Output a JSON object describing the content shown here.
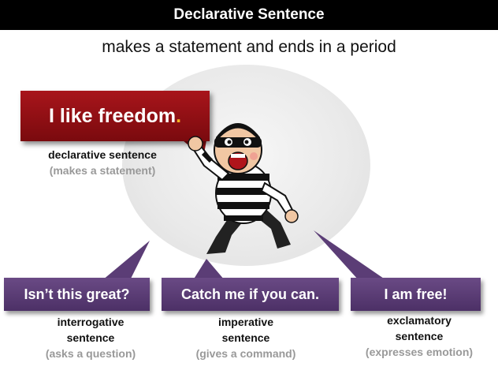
{
  "title": "Declarative Sentence",
  "subtitle": "makes a statement and ends in a period",
  "main_example": {
    "text": "I like freedom",
    "end_mark": "."
  },
  "main_caption": {
    "line1": "declarative sentence",
    "line2": "(makes a statement)"
  },
  "examples": [
    {
      "text": "Isn’t this great?",
      "line1": "interrogative",
      "line2": "sentence",
      "line3": "(asks a question)"
    },
    {
      "text": "Catch me if you can.",
      "line1": "imperative",
      "line2": "sentence",
      "line3": "(gives a command)"
    },
    {
      "text": "I am free!",
      "line1": "exclamatory",
      "line2": "sentence",
      "line3": "(expresses emotion)"
    }
  ],
  "colors": {
    "title_bg": "#000000",
    "main_box": "#9a1116",
    "example_box": "#5b3d76",
    "period_accent": "#f5b321"
  }
}
